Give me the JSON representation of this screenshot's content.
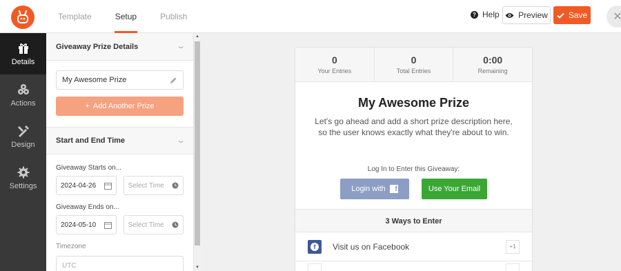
{
  "header": {
    "tabs": [
      {
        "label": "Template",
        "active": false
      },
      {
        "label": "Setup",
        "active": true
      },
      {
        "label": "Publish",
        "active": false
      }
    ],
    "help_label": "Help",
    "preview_label": "Preview",
    "save_label": "Save",
    "accent_color": "#f15a24"
  },
  "sidebar": {
    "items": [
      {
        "label": "Details",
        "icon": "gift-icon",
        "active": true
      },
      {
        "label": "Actions",
        "icon": "actions-icon",
        "active": false
      },
      {
        "label": "Design",
        "icon": "design-icon",
        "active": false
      },
      {
        "label": "Settings",
        "icon": "gear-icon",
        "active": false
      }
    ]
  },
  "panel": {
    "prize_section_title": "Giveaway Prize Details",
    "prize_name": "My Awesome Prize",
    "add_prize_label": "Add Another Prize",
    "time_section_title": "Start and End Time",
    "starts_label": "Giveaway Starts on...",
    "start_date": "2024-04-26",
    "start_time_placeholder": "Select Time",
    "ends_label": "Giveaway Ends on...",
    "end_date": "2024-05-10",
    "end_time_placeholder": "Select Time",
    "timezone_label": "Timezone",
    "timezone_value": "UTC"
  },
  "preview": {
    "stats": [
      {
        "value": "0",
        "label": "Your Entries"
      },
      {
        "value": "0",
        "label": "Total Entries"
      },
      {
        "value": "0:00",
        "label": "Remaining"
      }
    ],
    "title": "My Awesome Prize",
    "description": "Let's go ahead and add a short prize description here, so the user knows exactly what they're about to win.",
    "login_prompt": "Log In to Enter this Giveaway:",
    "facebook_login_label": "Login with",
    "email_label": "Use Your Email",
    "ways_title": "3 Ways to Enter",
    "entry_methods": [
      {
        "label": "Visit us on Facebook",
        "points": "+1"
      }
    ]
  }
}
